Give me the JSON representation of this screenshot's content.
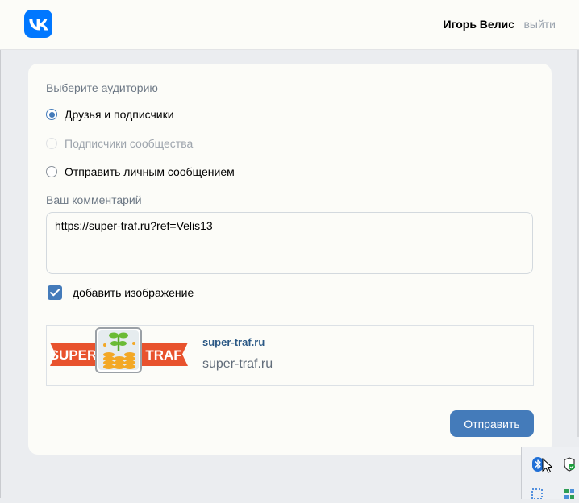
{
  "header": {
    "user_name": "Игорь Велис",
    "logout_label": "выйти",
    "brand_color": "#0077ff"
  },
  "form": {
    "audience_label": "Выберите аудиторию",
    "options": [
      {
        "label": "Друзья и подписчики",
        "checked": true,
        "disabled": false
      },
      {
        "label": "Подписчики сообщества",
        "checked": false,
        "disabled": true
      },
      {
        "label": "Отправить личным сообщением",
        "checked": false,
        "disabled": false
      }
    ],
    "comment_label": "Ваш комментарий",
    "comment_value": "https://super-traf.ru?ref=Velis13",
    "add_image_label": "добавить изображение",
    "add_image_checked": true,
    "preview": {
      "domain": "super-traf.ru",
      "title": "super-traf.ru",
      "logo_left_text": "SUPER",
      "logo_right_text": "TRAF"
    },
    "submit_label": "Отправить",
    "accent_color": "#447bba"
  },
  "system_tray": {
    "icons": [
      "bluetooth-icon",
      "security-shield-icon",
      "selection-icon",
      "grid-icon"
    ]
  }
}
